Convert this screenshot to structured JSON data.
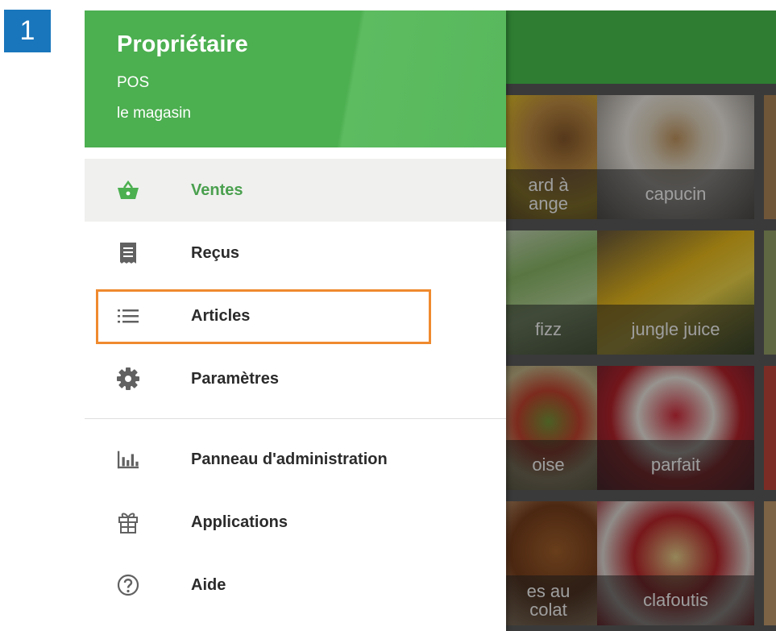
{
  "step": {
    "number": "1"
  },
  "drawer": {
    "role": "Propriétaire",
    "pos": "POS",
    "store": "le magasin",
    "items": [
      {
        "label": "Ventes",
        "icon": "basket-icon",
        "active": true
      },
      {
        "label": "Reçus",
        "icon": "receipt-icon"
      },
      {
        "label": "Articles",
        "icon": "list-icon",
        "highlighted": true
      },
      {
        "label": "Paramètres",
        "icon": "gear-icon"
      }
    ],
    "secondary_items": [
      {
        "label": "Panneau d'administration",
        "icon": "bar-chart-icon"
      },
      {
        "label": "Applications",
        "icon": "apps-icon"
      },
      {
        "label": "Aide",
        "icon": "help-icon"
      }
    ]
  },
  "grid": {
    "tiles": [
      {
        "label": "ard à\nange"
      },
      {
        "label": "capucin"
      },
      {
        "label": "fizz"
      },
      {
        "label": "jungle juice"
      },
      {
        "label": "oise"
      },
      {
        "label": "parfait"
      },
      {
        "label": "es au\ncolat"
      },
      {
        "label": "clafoutis"
      }
    ]
  },
  "colors": {
    "accent_green": "#4caf50",
    "appbar_green": "#2e7d32",
    "active_text": "#4aa04e",
    "highlight_orange": "#ef8a2e",
    "badge_blue": "#1976bc"
  }
}
